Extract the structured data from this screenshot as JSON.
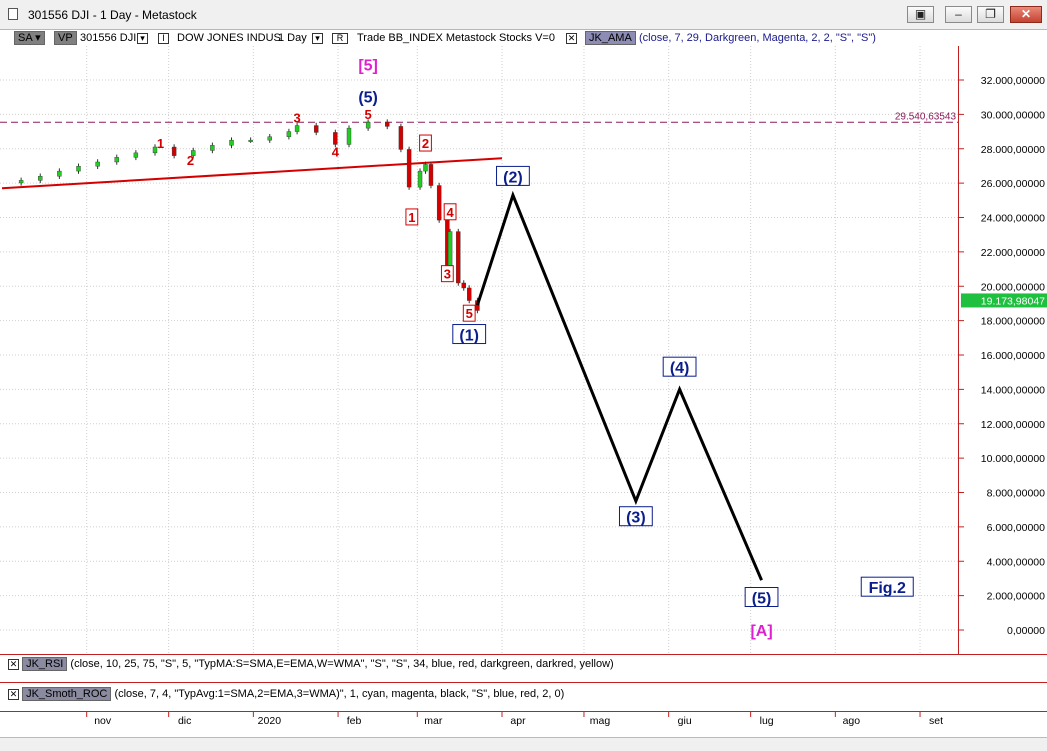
{
  "window": {
    "title": "301556 DJI - 1 Day - Metastock",
    "minimize_glyph": "–",
    "restore_glyph": "❐",
    "close_glyph": "✕",
    "extra_glyph": "▣"
  },
  "toolbar": {
    "sa_label": "SA",
    "vp_label": "VP",
    "security": "301556 DJI",
    "name": "DOW JONES INDUS",
    "period": "1 Day",
    "trade_text": "Trade  BB_INDEX  Metastock  Stocks  V=0",
    "indicator_name": "JK_AMA",
    "indicator_params": "(close,  7,  29,  Darkgreen,  Magenta,  2,  2,  \"S\",  \"S\")"
  },
  "panels": {
    "rsi_name": "JK_RSI",
    "rsi_params": "(close,  10,  25,  75,  \"S\",  5,  \"TypMA:S=SMA,E=EMA,W=WMA\",  \"S\",  \"S\",  34,  blue,  red,  darkgreen,  darkred,  yellow)",
    "roc_name": "JK_Smoth_ROC",
    "roc_params": "(close,  7,  4,  \"TypAvg:1=SMA,2=EMA,3=WMA)\",  1,  cyan,  magenta,  black,  \"S\",  blue,  red,  2,  0)"
  },
  "colors": {
    "red": "#d40000",
    "blue_label": "#0a1e8c",
    "magenta": "#e020d0",
    "candle_up": "#22cc22",
    "candle_down": "#d40000",
    "grid": "#cfcfcf",
    "axis_badge": "#1fbf3f"
  },
  "chart_data": {
    "type": "candlestick",
    "title": "301556 DJI - 1 Day - Metastock",
    "y_axis": {
      "min": 0,
      "max": 32000,
      "ticks": [
        "0,00000",
        "2.000,00000",
        "4.000,00000",
        "6.000,00000",
        "8.000,00000",
        "10.000,00000",
        "12.000,00000",
        "14.000,00000",
        "16.000,00000",
        "18.000,00000",
        "20.000,00000",
        "22.000,00000",
        "24.000,00000",
        "26.000,00000",
        "28.000,00000",
        "30.000,00000",
        "32.000,00000"
      ],
      "tick_values": [
        0,
        2000,
        4000,
        6000,
        8000,
        10000,
        12000,
        14000,
        16000,
        18000,
        20000,
        22000,
        24000,
        26000,
        28000,
        30000,
        32000
      ]
    },
    "x_axis": {
      "labels": [
        "nov",
        "dic",
        "2020",
        "feb",
        "mar",
        "apr",
        "mag",
        "giu",
        "lug",
        "ago",
        "set"
      ],
      "label_dates": [
        "2019-11-01",
        "2019-12-01",
        "2020-01-01",
        "2020-02-01",
        "2020-03-01",
        "2020-04-01",
        "2020-05-01",
        "2020-06-01",
        "2020-07-01",
        "2020-08-01",
        "2020-09-01"
      ]
    },
    "price_series": {
      "name": "DJI",
      "points": [
        [
          "2019-10-08",
          26160
        ],
        [
          "2019-10-15",
          26400
        ],
        [
          "2019-10-22",
          26700
        ],
        [
          "2019-10-29",
          26980
        ],
        [
          "2019-11-05",
          27230
        ],
        [
          "2019-11-12",
          27500
        ],
        [
          "2019-11-19",
          27760
        ],
        [
          "2019-11-26",
          28100
        ],
        [
          "2019-12-03",
          27600
        ],
        [
          "2019-12-10",
          27900
        ],
        [
          "2019-12-17",
          28200
        ],
        [
          "2019-12-24",
          28500
        ],
        [
          "2019-12-31",
          28500
        ],
        [
          "2020-01-07",
          28700
        ],
        [
          "2020-01-14",
          29000
        ],
        [
          "2020-01-17",
          29350
        ],
        [
          "2020-01-24",
          28950
        ],
        [
          "2020-01-31",
          28250
        ],
        [
          "2020-02-05",
          29200
        ],
        [
          "2020-02-12",
          29550
        ],
        [
          "2020-02-19",
          29300
        ],
        [
          "2020-02-24",
          27960
        ],
        [
          "2020-02-27",
          25770
        ],
        [
          "2020-03-02",
          26700
        ],
        [
          "2020-03-04",
          27090
        ],
        [
          "2020-03-06",
          25860
        ],
        [
          "2020-03-09",
          23850
        ],
        [
          "2020-03-12",
          21200
        ],
        [
          "2020-03-13",
          23180
        ],
        [
          "2020-03-16",
          20190
        ],
        [
          "2020-03-18",
          19900
        ],
        [
          "2020-03-20",
          19170
        ],
        [
          "2020-03-23",
          18590
        ]
      ]
    },
    "resistance_line": {
      "value": 29540.63543,
      "label": "29.540,63543"
    },
    "last_price": {
      "value": 19173.98047,
      "label": "19.173,98047"
    },
    "trendline": {
      "points": [
        [
          "2019-10-01",
          25700
        ],
        [
          "2020-04-01",
          27450
        ]
      ]
    },
    "projection": {
      "points": [
        [
          "2020-03-23",
          18900
        ],
        [
          "2020-04-05",
          25300
        ],
        [
          "2020-05-20",
          7500
        ],
        [
          "2020-06-05",
          14000
        ],
        [
          "2020-07-05",
          2900
        ]
      ]
    },
    "wave_labels": [
      {
        "text": "1",
        "date": "2019-11-28",
        "value": 28100,
        "color": "red",
        "style": "plain"
      },
      {
        "text": "2",
        "date": "2019-12-09",
        "value": 27100,
        "color": "red",
        "style": "plain"
      },
      {
        "text": "3",
        "date": "2020-01-17",
        "value": 29600,
        "color": "red",
        "style": "plain"
      },
      {
        "text": "4",
        "date": "2020-01-31",
        "value": 27600,
        "color": "red",
        "style": "plain"
      },
      {
        "text": "5",
        "date": "2020-02-12",
        "value": 29800,
        "color": "red",
        "style": "plain"
      },
      {
        "text": "(5)",
        "date": "2020-02-12",
        "value": 30750,
        "color": "blue",
        "style": "plain"
      },
      {
        "text": "[5]",
        "date": "2020-02-12",
        "value": 32600,
        "color": "magenta",
        "style": "plain"
      },
      {
        "text": "1",
        "date": "2020-02-28",
        "value": 23800,
        "color": "red",
        "style": "box"
      },
      {
        "text": "2",
        "date": "2020-03-04",
        "value": 28100,
        "color": "red",
        "style": "box"
      },
      {
        "text": "3",
        "date": "2020-03-12",
        "value": 20500,
        "color": "red",
        "style": "box"
      },
      {
        "text": "4",
        "date": "2020-03-13",
        "value": 24100,
        "color": "red",
        "style": "box"
      },
      {
        "text": "5",
        "date": "2020-03-20",
        "value": 18200,
        "color": "red",
        "style": "box"
      },
      {
        "text": "(1)",
        "date": "2020-03-20",
        "value": 16900,
        "color": "blue",
        "style": "box"
      },
      {
        "text": "(2)",
        "date": "2020-04-05",
        "value": 26100,
        "color": "blue",
        "style": "box"
      },
      {
        "text": "(3)",
        "date": "2020-05-20",
        "value": 6300,
        "color": "blue",
        "style": "box"
      },
      {
        "text": "(4)",
        "date": "2020-06-05",
        "value": 15000,
        "color": "blue",
        "style": "box"
      },
      {
        "text": "(5)",
        "date": "2020-07-05",
        "value": 1600,
        "color": "blue",
        "style": "box"
      },
      {
        "text": "[A]",
        "date": "2020-07-05",
        "value": -300,
        "color": "magenta",
        "style": "plain"
      }
    ],
    "annotations": [
      {
        "text": "Fig.2",
        "date": "2020-08-20",
        "value": 2200,
        "color": "blue",
        "style": "box"
      }
    ]
  }
}
